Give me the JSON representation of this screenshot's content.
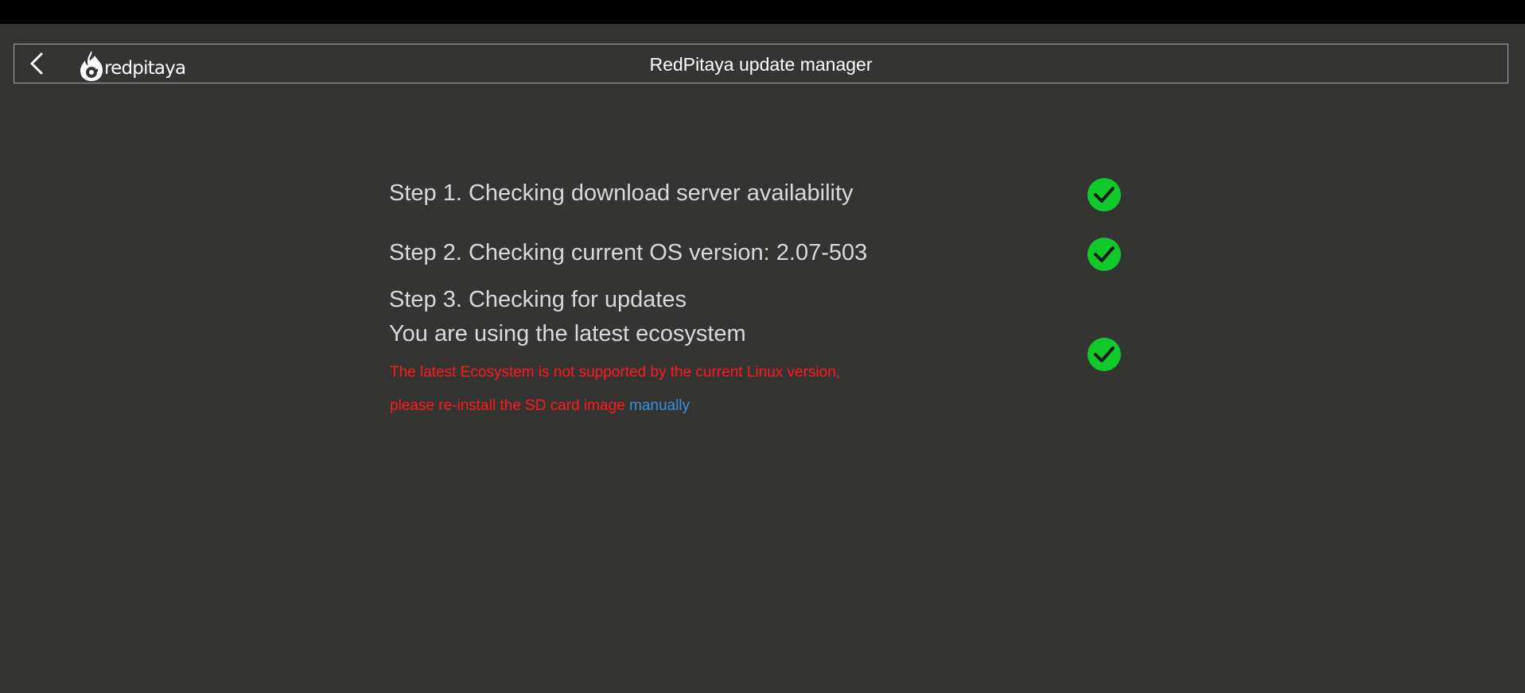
{
  "header": {
    "title": "RedPitaya update manager",
    "logo_text": "redpitaya",
    "back_icon": "chevron-left-icon"
  },
  "steps": [
    {
      "label": "Step 1. Checking download server availability",
      "status": "ok"
    },
    {
      "label": "Step 2. Checking current OS version: 2.07-503",
      "status": "ok"
    },
    {
      "label": "Step 3. Checking for updates",
      "status": "ok"
    }
  ],
  "result": {
    "message": "You are using the latest ecosystem",
    "warning_line1": "The latest Ecosystem is not supported by the current Linux version,",
    "warning_line2": "please re-install the SD card image ",
    "warning_link": "manually"
  },
  "colors": {
    "background": "#343433",
    "check_green": "#10c92a",
    "warning_red": "#ff1a1a",
    "link_blue": "#3a8fd8"
  }
}
